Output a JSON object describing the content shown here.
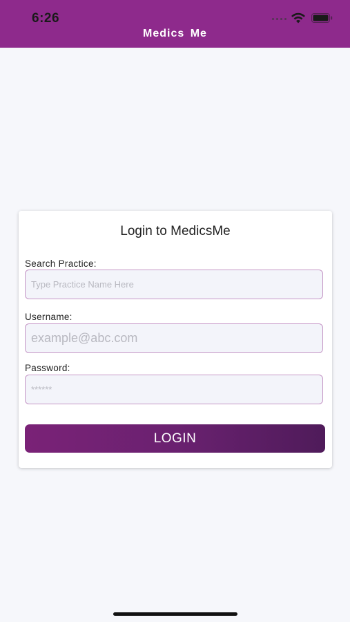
{
  "status_bar": {
    "time": "6:26",
    "icons": [
      "signal-dots-icon",
      "wifi-icon",
      "battery-icon"
    ]
  },
  "header": {
    "title": "Medics Me"
  },
  "login_card": {
    "title": "Login to MedicsMe",
    "practice": {
      "label": "Search Practice:",
      "placeholder": "Type Practice Name Here",
      "value": ""
    },
    "username": {
      "label": "Username:",
      "placeholder": "example@abc.com",
      "value": ""
    },
    "password": {
      "label": "Password:",
      "placeholder": "******",
      "value": ""
    },
    "login_button": "LOGIN"
  },
  "colors": {
    "header_bg": "#8e2a8c",
    "button_start": "#7a2277",
    "button_end": "#4f1b5a",
    "field_border": "#c596c6",
    "page_bg": "#f6f7fb"
  }
}
